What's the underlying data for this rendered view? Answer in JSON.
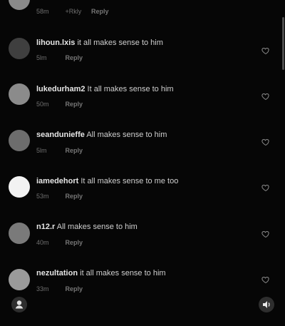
{
  "comments": [
    {
      "username": "",
      "text": "",
      "time": "58m",
      "extra": "+Rkly",
      "reply": "Reply",
      "avatar_color": "#8a8a8a"
    },
    {
      "username": "lihoun.lxis",
      "text": "it all makes sense to him",
      "time": "5lm",
      "reply": "Reply",
      "avatar_color": "#3f3f3f"
    },
    {
      "username": "lukedurham2",
      "text": "It all makes sense to him",
      "time": "50m",
      "reply": "Reply",
      "avatar_color": "#8b8b8b"
    },
    {
      "username": "seandunieffe",
      "text": "All makes sense to him",
      "time": "5lm",
      "reply": "Reply",
      "avatar_color": "#6d6d6d"
    },
    {
      "username": "iamedehort",
      "text": "It all makes sense to me too",
      "time": "53m",
      "reply": "Reply",
      "avatar_color": "#f2f2f2"
    },
    {
      "username": "n12.r",
      "text": "All makes sense to him",
      "time": "40m",
      "reply": "Reply",
      "avatar_color": "#7a7a7a"
    },
    {
      "username": "nezultation",
      "text": "it all makes sense to him",
      "time": "33m",
      "reply": "Reply",
      "avatar_color": "#9a9a9a"
    }
  ],
  "icons": {
    "heart": "heart-icon",
    "profile": "person-icon",
    "sound": "speaker-icon"
  },
  "colors": {
    "background": "#060606",
    "username": "#e6e6e6",
    "comment_text": "#cfcfcf",
    "meta": "#6f6f6f"
  }
}
